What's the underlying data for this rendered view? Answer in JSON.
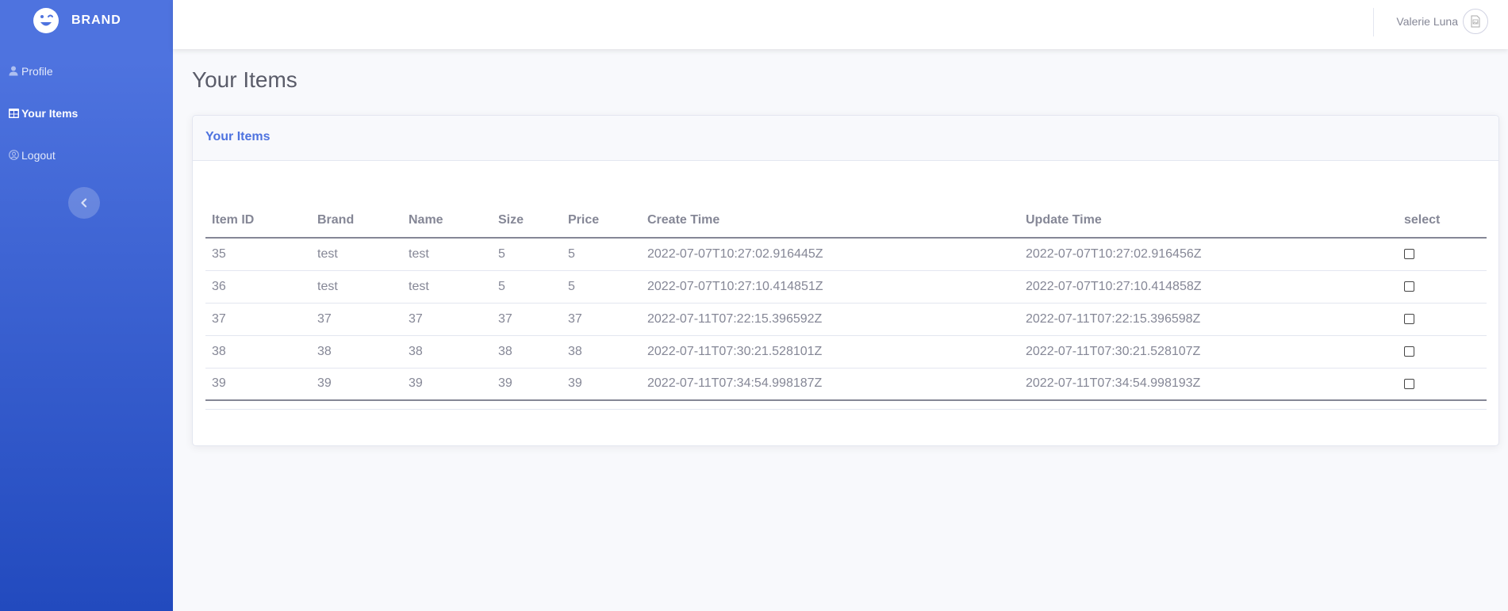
{
  "sidebar": {
    "brand": "BRAND",
    "items": [
      {
        "label": "Profile",
        "icon": "user-icon"
      },
      {
        "label": "Your Items",
        "icon": "table-icon"
      },
      {
        "label": "Logout",
        "icon": "user-circle-icon"
      }
    ],
    "toggle_icon": "chevron-left-icon"
  },
  "topbar": {
    "user_name": "Valerie Luna",
    "avatar_icon": "avatar-image-icon"
  },
  "page": {
    "title": "Your Items"
  },
  "card": {
    "header": "Your Items",
    "table": {
      "columns": [
        "Item ID",
        "Brand",
        "Name",
        "Size",
        "Price",
        "Create Time",
        "Update Time",
        "select"
      ],
      "rows": [
        {
          "id": "35",
          "brand": "test",
          "name": "test",
          "size": "5",
          "price": "5",
          "create": "2022-07-07T10:27:02.916445Z",
          "update": "2022-07-07T10:27:02.916456Z"
        },
        {
          "id": "36",
          "brand": "test",
          "name": "test",
          "size": "5",
          "price": "5",
          "create": "2022-07-07T10:27:10.414851Z",
          "update": "2022-07-07T10:27:10.414858Z"
        },
        {
          "id": "37",
          "brand": "37",
          "name": "37",
          "size": "37",
          "price": "37",
          "create": "2022-07-11T07:22:15.396592Z",
          "update": "2022-07-11T07:22:15.396598Z"
        },
        {
          "id": "38",
          "brand": "38",
          "name": "38",
          "size": "38",
          "price": "38",
          "create": "2022-07-11T07:30:21.528101Z",
          "update": "2022-07-11T07:30:21.528107Z"
        },
        {
          "id": "39",
          "brand": "39",
          "name": "39",
          "size": "39",
          "price": "39",
          "create": "2022-07-11T07:34:54.998187Z",
          "update": "2022-07-11T07:34:54.998193Z"
        }
      ]
    }
  },
  "colors": {
    "accent": "#4e73df",
    "sidebar_gradient_end": "#224abe",
    "text": "#858796",
    "background": "#f8f9fc"
  }
}
